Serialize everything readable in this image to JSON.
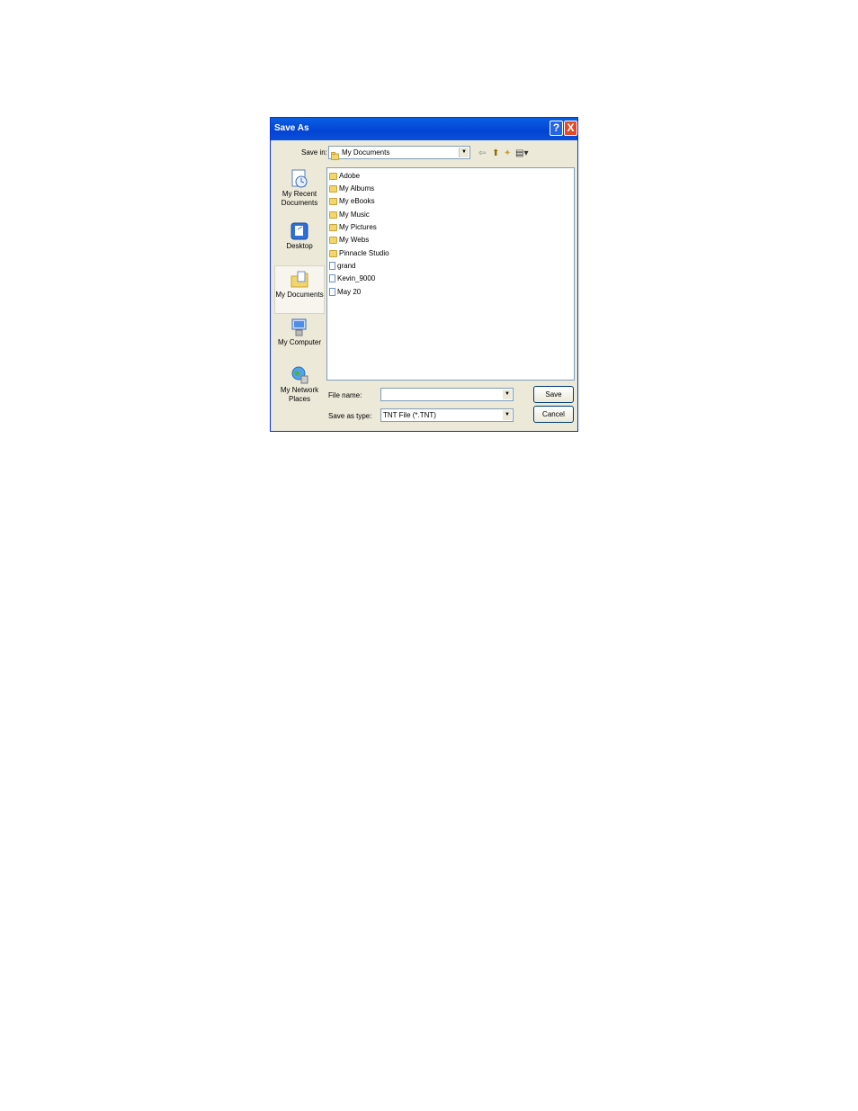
{
  "window": {
    "title": "Save As",
    "help": "?",
    "close": "X"
  },
  "save_in": {
    "label": "Save in:",
    "value": "My Documents"
  },
  "toolbar": {
    "back": "⇦",
    "up": "⬆",
    "new_folder": "✦",
    "views": "▤▾"
  },
  "places": [
    {
      "label": "My Recent Documents",
      "icon": "recent-docs-icon"
    },
    {
      "label": "Desktop",
      "icon": "desktop-icon"
    },
    {
      "label": "My Documents",
      "icon": "my-documents-icon"
    },
    {
      "label": "My Computer",
      "icon": "my-computer-icon"
    },
    {
      "label": "My Network Places",
      "icon": "network-places-icon"
    }
  ],
  "files": [
    {
      "name": "Adobe",
      "type": "folder"
    },
    {
      "name": "My Albums",
      "type": "folder"
    },
    {
      "name": "My eBooks",
      "type": "folder"
    },
    {
      "name": "My Music",
      "type": "folder"
    },
    {
      "name": "My Pictures",
      "type": "folder"
    },
    {
      "name": "My Webs",
      "type": "folder"
    },
    {
      "name": "Pinnacle Studio",
      "type": "folder"
    },
    {
      "name": "grand",
      "type": "file"
    },
    {
      "name": "Kevin_9000",
      "type": "file"
    },
    {
      "name": "May 20",
      "type": "file"
    }
  ],
  "file_name": {
    "label": "File name:",
    "value": ""
  },
  "save_as_type": {
    "label": "Save as type:",
    "value": "TNT File (*.TNT)"
  },
  "buttons": {
    "save": "Save",
    "cancel": "Cancel"
  }
}
